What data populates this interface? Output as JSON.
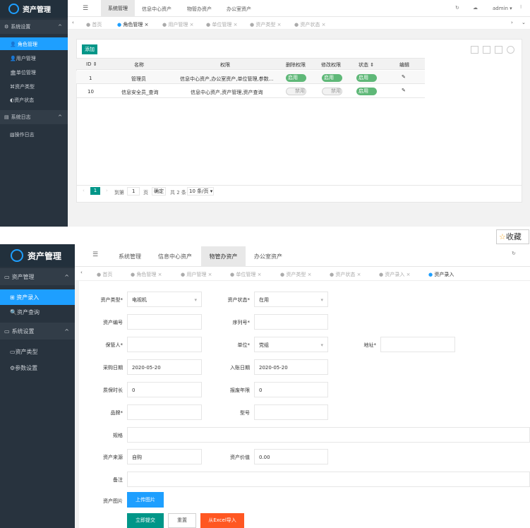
{
  "shot1": {
    "app_title": "资产管理",
    "topnav": [
      "系统管理",
      "信息中心资产",
      "物管办资产",
      "办公室资产"
    ],
    "user": "admin",
    "sidebar": {
      "groups": [
        {
          "label": "系统设置",
          "items": [
            "角色管理",
            "用户管理",
            "单位管理",
            "资产类型",
            "资产状态"
          ]
        },
        {
          "label": "系统日志",
          "items": [
            "操作日志"
          ]
        }
      ]
    },
    "tabs": [
      "首页",
      "角色管理",
      "用户管理",
      "单位管理",
      "资产类型",
      "资产状态"
    ],
    "add_button": "添加",
    "table": {
      "headers": [
        "ID",
        "名称",
        "权限",
        "删除权限",
        "修改权限",
        "状态",
        "编辑"
      ],
      "rows": [
        {
          "id": "1",
          "name": "管理员",
          "perm": "信息中心资产,办公室资产,单位管理,参数...",
          "del": "启用",
          "mod": "启用",
          "status": "启用"
        },
        {
          "id": "10",
          "name": "信息安全员_查询",
          "perm": "信息中心资产,资产管理,资产查询",
          "del": "禁用",
          "mod": "禁用",
          "status": "启用"
        }
      ]
    },
    "pagination": {
      "current": "1",
      "goto_label": "到第",
      "goto_value": "1",
      "page_unit": "页",
      "confirm": "确定",
      "total": "共 2 条",
      "page_size": "10 条/页"
    }
  },
  "favorite": "收藏",
  "shot2": {
    "app_title": "资产管理",
    "topnav": [
      "系统管理",
      "信息中心资产",
      "物管办资产",
      "办公室资产"
    ],
    "sidebar": {
      "groups": [
        {
          "label": "资产管理",
          "items": [
            "资产录入",
            "资产查询"
          ]
        },
        {
          "label": "系统设置",
          "items": [
            "资产类型",
            "参数设置"
          ]
        }
      ]
    },
    "tabs": [
      "首页",
      "角色管理",
      "用户管理",
      "单位管理",
      "资产类型",
      "资产状态",
      "资产录入",
      "资产录入"
    ],
    "form": {
      "asset_type": {
        "label": "资产类型*",
        "value": "电视机"
      },
      "asset_status": {
        "label": "资产状态*",
        "value": "在用"
      },
      "asset_no": {
        "label": "资产编号",
        "value": ""
      },
      "serial_no": {
        "label": "序列号*",
        "value": ""
      },
      "keeper": {
        "label": "保管人*",
        "value": ""
      },
      "unit": {
        "label": "单位*",
        "value": "党组"
      },
      "address": {
        "label": "地址*",
        "value": ""
      },
      "purchase_date": {
        "label": "采购日期",
        "value": "2020-05-20"
      },
      "entry_date": {
        "label": "入账日期",
        "value": "2020-05-20"
      },
      "warranty": {
        "label": "质保时长",
        "value": "0"
      },
      "scrap_years": {
        "label": "报废年限",
        "value": "0"
      },
      "brand": {
        "label": "品牌*",
        "value": ""
      },
      "model": {
        "label": "型号",
        "value": ""
      },
      "spec": {
        "label": "规格",
        "value": ""
      },
      "source": {
        "label": "资产来源",
        "value": "自购"
      },
      "price": {
        "label": "资产价值",
        "value": "0.00"
      },
      "note": {
        "label": "备注",
        "value": ""
      },
      "image": {
        "label": "资产图片",
        "button": "上传图片"
      }
    },
    "buttons": {
      "submit": "立即提交",
      "reset": "重置",
      "import": "从Excel导入"
    }
  },
  "colors": {
    "sidebar": "#28333e",
    "active": "#1e9fff",
    "teal": "#009688",
    "green": "#5fb878",
    "orange": "#ff5722"
  }
}
